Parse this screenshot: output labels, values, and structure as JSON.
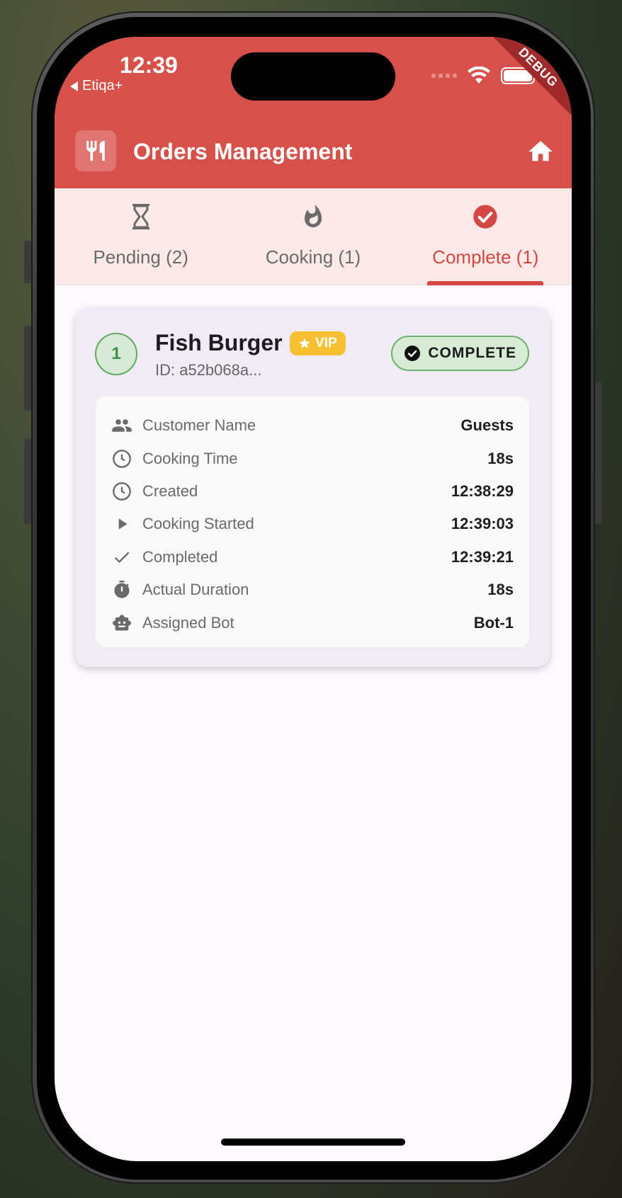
{
  "status_bar": {
    "time": "12:39",
    "carrier": "Etiqa+",
    "debug_label": "DEBUG"
  },
  "app_bar": {
    "title": "Orders Management",
    "leading_icon": "restaurant-icon",
    "action_icon": "home-icon",
    "color": "#d7504a"
  },
  "tabs": [
    {
      "label": "Pending (2)",
      "icon": "hourglass-icon",
      "active": false
    },
    {
      "label": "Cooking (1)",
      "icon": "flame-icon",
      "active": false
    },
    {
      "label": "Complete (1)",
      "icon": "check-circle-icon",
      "active": true
    }
  ],
  "order": {
    "number": "1",
    "name": "Fish Burger",
    "badge": "VIP",
    "id_text": "ID: a52b068a...",
    "status": "COMPLETE",
    "details": [
      {
        "icon": "people-icon",
        "label": "Customer Name",
        "value": "Guests"
      },
      {
        "icon": "clock-icon",
        "label": "Cooking Time",
        "value": "18s"
      },
      {
        "icon": "clock-icon",
        "label": "Created",
        "value": "12:38:29"
      },
      {
        "icon": "play-icon",
        "label": "Cooking Started",
        "value": "12:39:03"
      },
      {
        "icon": "check-icon",
        "label": "Completed",
        "value": "12:39:21"
      },
      {
        "icon": "timer-icon",
        "label": "Actual Duration",
        "value": "18s"
      },
      {
        "icon": "robot-icon",
        "label": "Assigned Bot",
        "value": "Bot-1"
      }
    ]
  },
  "colors": {
    "accent": "#d54742",
    "success": "#5fab62",
    "vip": "#f7c033"
  }
}
